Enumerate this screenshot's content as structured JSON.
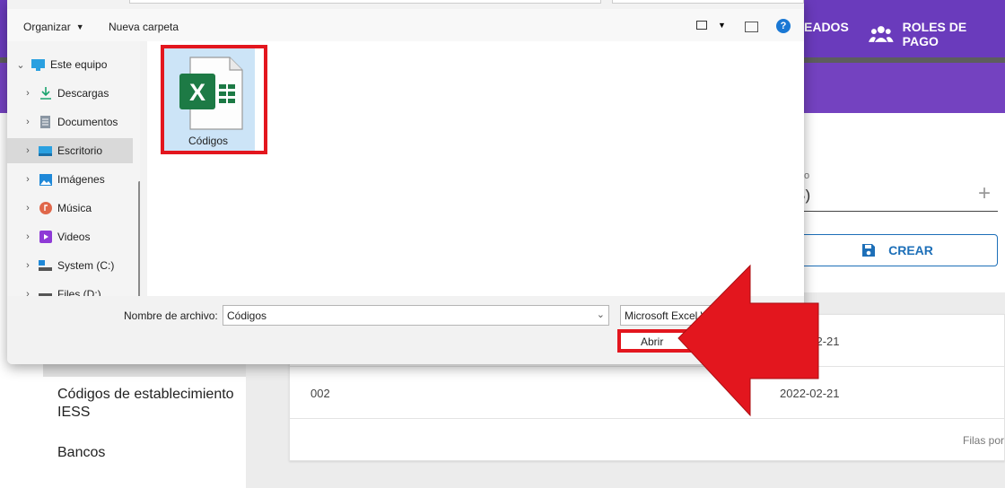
{
  "app": {
    "nav": [
      {
        "label": "EADOS",
        "icon": "users-icon"
      },
      {
        "label": "ROLES DE PAGO",
        "icon": "group-icon"
      }
    ],
    "sidebar": {
      "links": [
        "Códigos de establecimiento IESS",
        "Bancos"
      ]
    },
    "form": {
      "field_label": "o",
      "field_value": "0 B)",
      "add_icon": "plus-icon",
      "create_label": "CREAR",
      "create_icon": "save-icon"
    },
    "table": {
      "rows": [
        {
          "code": "",
          "date": "2022-02-21"
        },
        {
          "code": "002",
          "date": "2022-02-21"
        }
      ],
      "footer": "Filas por"
    },
    "colors": {
      "header_purple": "#6a3bbc",
      "accent_blue": "#1d6fb8",
      "highlight_red": "#e3161e"
    }
  },
  "dialog": {
    "toolbar": {
      "organize": "Organizar",
      "new_folder": "Nueva carpeta"
    },
    "tree": [
      {
        "label": "Este equipo",
        "icon": "pc-icon",
        "expanded": true
      },
      {
        "label": "Descargas",
        "icon": "download-icon"
      },
      {
        "label": "Documentos",
        "icon": "documents-icon"
      },
      {
        "label": "Escritorio",
        "icon": "desktop-icon",
        "selected": true
      },
      {
        "label": "Imágenes",
        "icon": "pictures-icon"
      },
      {
        "label": "Música",
        "icon": "music-icon"
      },
      {
        "label": "Videos",
        "icon": "videos-icon"
      },
      {
        "label": "System (C:)",
        "icon": "drive-icon"
      },
      {
        "label": "Files (D:)",
        "icon": "drive-icon"
      }
    ],
    "files": [
      {
        "name": "Códigos",
        "icon": "excel-file-icon",
        "selected": true
      }
    ],
    "filename_label": "Nombre de archivo:",
    "filename_value": "Códigos",
    "filetype": "Microsoft Excel W",
    "open_label": "Abrir"
  }
}
